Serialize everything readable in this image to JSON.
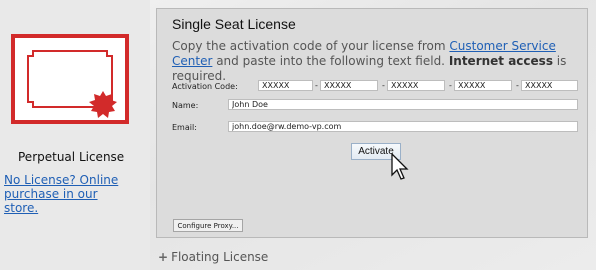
{
  "left": {
    "perpetual_label": "Perpetual License",
    "store_link": "No License? Online purchase in our store."
  },
  "panel": {
    "title": "Single Seat License",
    "desc_prefix": "Copy the activation code of your license from ",
    "desc_link": "Customer Service Center",
    "desc_mid": " and paste into the following text field. ",
    "desc_bold": "Internet access",
    "desc_suffix": " is required.",
    "activation_label": "Activation Code:",
    "code_fields": [
      "XXXXX",
      "XXXXX",
      "XXXXX",
      "XXXXX",
      "XXXXX"
    ],
    "separator": "-",
    "name_label": "Name:",
    "name_value": "John Doe",
    "email_label": "Email:",
    "email_value": "john.doe@rw.demo-vp.com",
    "activate_button": "Activate",
    "proxy_button": "Configure Proxy..."
  },
  "floating": {
    "plus": "+",
    "label": "Floating License"
  },
  "colors": {
    "accent_red": "#d22a2a",
    "link_blue": "#1f5fb5"
  }
}
